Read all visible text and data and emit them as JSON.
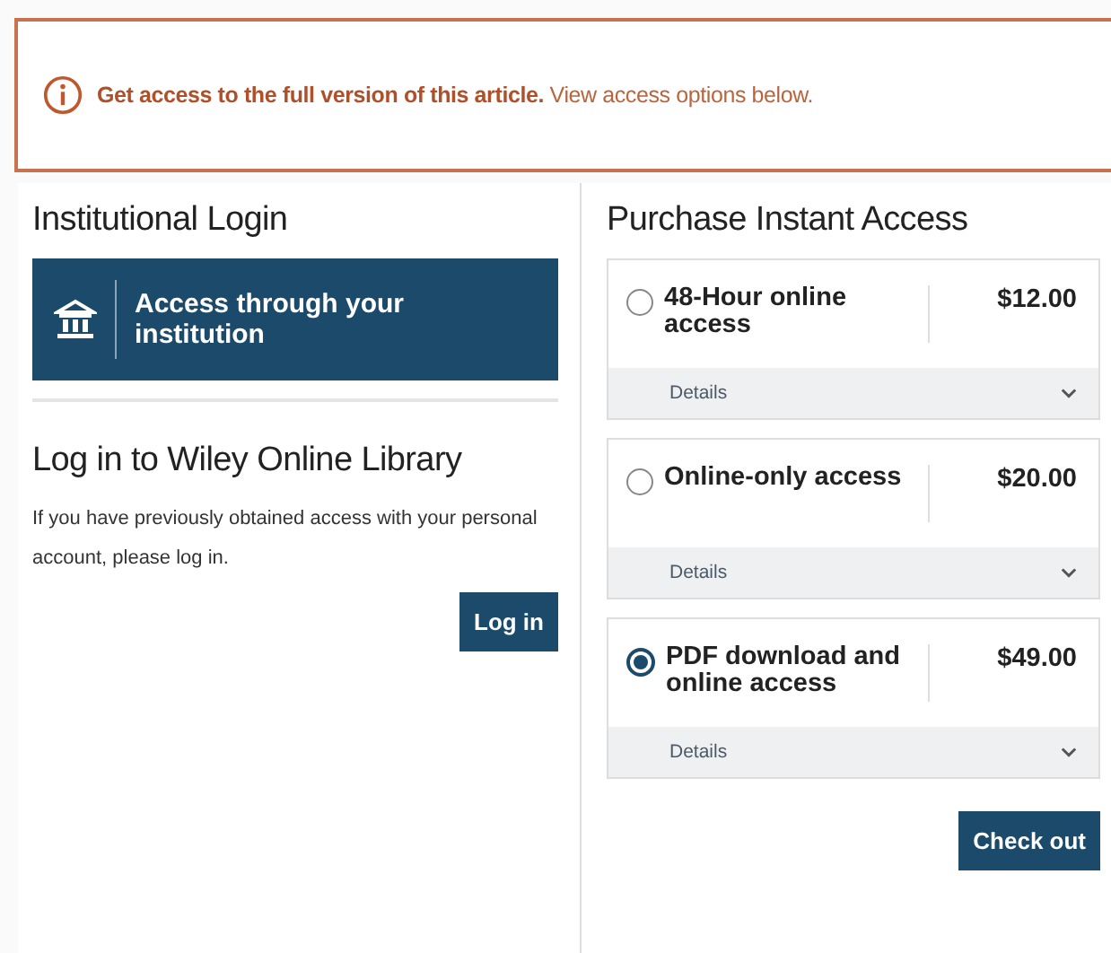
{
  "banner": {
    "text": "**Get access to the full version of this article.** View access options below."
  },
  "institutional": {
    "heading": "Institutional Login",
    "button": "Access through your institution"
  },
  "login": {
    "heading": "Log in to Wiley Online Library",
    "text": "If you have previously obtained access with your personal account, please log in.",
    "button": "Log in"
  },
  "purchase": {
    "heading": "Purchase Instant Access",
    "options": [
      {
        "label": "48-Hour online access",
        "price": "$12.00",
        "details": "Details",
        "selected": false
      },
      {
        "label": "Online-only access",
        "price": "$20.00",
        "details": "Details",
        "selected": false
      },
      {
        "label": "PDF download and online access",
        "price": "$49.00",
        "details": "Details",
        "selected": true
      }
    ],
    "button": "Check out"
  }
}
